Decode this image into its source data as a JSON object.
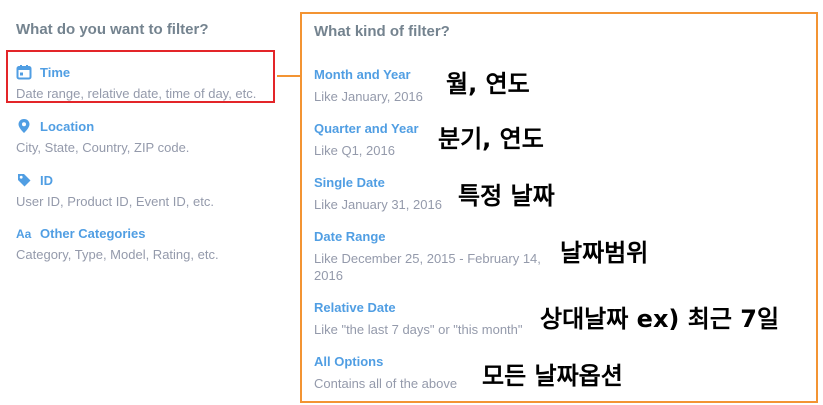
{
  "left": {
    "title": "What do you want to filter?",
    "categories": [
      {
        "icon": "calendar-icon",
        "name": "Time",
        "desc": "Date range, relative date, time of day, etc."
      },
      {
        "icon": "location-pin-icon",
        "name": "Location",
        "desc": "City, State, Country, ZIP code."
      },
      {
        "icon": "tag-icon",
        "name": "ID",
        "desc": "User ID, Product ID, Event ID, etc."
      },
      {
        "icon": "text-aa-icon",
        "glyph": "Aa",
        "name": "Other Categories",
        "desc": "Category, Type, Model, Rating, etc."
      }
    ]
  },
  "right": {
    "title": "What kind of filter?",
    "options": [
      {
        "name": "Month and Year",
        "desc": "Like January, 2016",
        "annotation": "월, 연도"
      },
      {
        "name": "Quarter and Year",
        "desc": "Like Q1, 2016",
        "annotation": "분기, 연도"
      },
      {
        "name": "Single Date",
        "desc": "Like January 31, 2016",
        "annotation": "특정 날짜"
      },
      {
        "name": "Date Range",
        "desc": "Like December 25, 2015 - February 14, 2016",
        "annotation": "날짜범위"
      },
      {
        "name": "Relative Date",
        "desc": "Like \"the last 7 days\" or \"this month\"",
        "annotation": "상대날짜 ex) 최근 7일"
      },
      {
        "name": "All Options",
        "desc": "Contains all of the above",
        "annotation": "모든 날짜옵션"
      }
    ]
  },
  "colors": {
    "accent": "#509ee3",
    "muted_text": "#949aab",
    "heading_text": "#74838f",
    "highlight_red": "#e32529",
    "highlight_orange": "#f39433"
  }
}
